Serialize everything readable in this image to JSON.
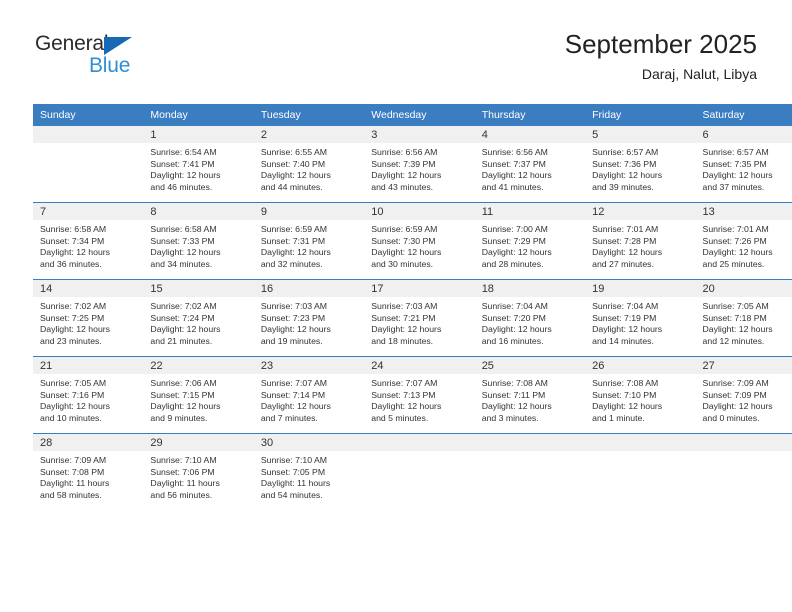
{
  "brand": {
    "name_dark": "General",
    "name_light": "Blue",
    "triangle_color": "#1669b2",
    "light_color": "#2f8fd4"
  },
  "header": {
    "title": "September 2025",
    "subtitle": "Daraj, Nalut, Libya"
  },
  "theme": {
    "header_blue": "#3b7dc1",
    "day_band_gray": "#f0f0f0",
    "text_color": "#333333"
  },
  "weekdays": [
    "Sunday",
    "Monday",
    "Tuesday",
    "Wednesday",
    "Thursday",
    "Friday",
    "Saturday"
  ],
  "weeks": [
    [
      {
        "day": "",
        "sunrise": "",
        "sunset": "",
        "daylight1": "",
        "daylight2": ""
      },
      {
        "day": "1",
        "sunrise": "Sunrise: 6:54 AM",
        "sunset": "Sunset: 7:41 PM",
        "daylight1": "Daylight: 12 hours",
        "daylight2": "and 46 minutes."
      },
      {
        "day": "2",
        "sunrise": "Sunrise: 6:55 AM",
        "sunset": "Sunset: 7:40 PM",
        "daylight1": "Daylight: 12 hours",
        "daylight2": "and 44 minutes."
      },
      {
        "day": "3",
        "sunrise": "Sunrise: 6:56 AM",
        "sunset": "Sunset: 7:39 PM",
        "daylight1": "Daylight: 12 hours",
        "daylight2": "and 43 minutes."
      },
      {
        "day": "4",
        "sunrise": "Sunrise: 6:56 AM",
        "sunset": "Sunset: 7:37 PM",
        "daylight1": "Daylight: 12 hours",
        "daylight2": "and 41 minutes."
      },
      {
        "day": "5",
        "sunrise": "Sunrise: 6:57 AM",
        "sunset": "Sunset: 7:36 PM",
        "daylight1": "Daylight: 12 hours",
        "daylight2": "and 39 minutes."
      },
      {
        "day": "6",
        "sunrise": "Sunrise: 6:57 AM",
        "sunset": "Sunset: 7:35 PM",
        "daylight1": "Daylight: 12 hours",
        "daylight2": "and 37 minutes."
      }
    ],
    [
      {
        "day": "7",
        "sunrise": "Sunrise: 6:58 AM",
        "sunset": "Sunset: 7:34 PM",
        "daylight1": "Daylight: 12 hours",
        "daylight2": "and 36 minutes."
      },
      {
        "day": "8",
        "sunrise": "Sunrise: 6:58 AM",
        "sunset": "Sunset: 7:33 PM",
        "daylight1": "Daylight: 12 hours",
        "daylight2": "and 34 minutes."
      },
      {
        "day": "9",
        "sunrise": "Sunrise: 6:59 AM",
        "sunset": "Sunset: 7:31 PM",
        "daylight1": "Daylight: 12 hours",
        "daylight2": "and 32 minutes."
      },
      {
        "day": "10",
        "sunrise": "Sunrise: 6:59 AM",
        "sunset": "Sunset: 7:30 PM",
        "daylight1": "Daylight: 12 hours",
        "daylight2": "and 30 minutes."
      },
      {
        "day": "11",
        "sunrise": "Sunrise: 7:00 AM",
        "sunset": "Sunset: 7:29 PM",
        "daylight1": "Daylight: 12 hours",
        "daylight2": "and 28 minutes."
      },
      {
        "day": "12",
        "sunrise": "Sunrise: 7:01 AM",
        "sunset": "Sunset: 7:28 PM",
        "daylight1": "Daylight: 12 hours",
        "daylight2": "and 27 minutes."
      },
      {
        "day": "13",
        "sunrise": "Sunrise: 7:01 AM",
        "sunset": "Sunset: 7:26 PM",
        "daylight1": "Daylight: 12 hours",
        "daylight2": "and 25 minutes."
      }
    ],
    [
      {
        "day": "14",
        "sunrise": "Sunrise: 7:02 AM",
        "sunset": "Sunset: 7:25 PM",
        "daylight1": "Daylight: 12 hours",
        "daylight2": "and 23 minutes."
      },
      {
        "day": "15",
        "sunrise": "Sunrise: 7:02 AM",
        "sunset": "Sunset: 7:24 PM",
        "daylight1": "Daylight: 12 hours",
        "daylight2": "and 21 minutes."
      },
      {
        "day": "16",
        "sunrise": "Sunrise: 7:03 AM",
        "sunset": "Sunset: 7:23 PM",
        "daylight1": "Daylight: 12 hours",
        "daylight2": "and 19 minutes."
      },
      {
        "day": "17",
        "sunrise": "Sunrise: 7:03 AM",
        "sunset": "Sunset: 7:21 PM",
        "daylight1": "Daylight: 12 hours",
        "daylight2": "and 18 minutes."
      },
      {
        "day": "18",
        "sunrise": "Sunrise: 7:04 AM",
        "sunset": "Sunset: 7:20 PM",
        "daylight1": "Daylight: 12 hours",
        "daylight2": "and 16 minutes."
      },
      {
        "day": "19",
        "sunrise": "Sunrise: 7:04 AM",
        "sunset": "Sunset: 7:19 PM",
        "daylight1": "Daylight: 12 hours",
        "daylight2": "and 14 minutes."
      },
      {
        "day": "20",
        "sunrise": "Sunrise: 7:05 AM",
        "sunset": "Sunset: 7:18 PM",
        "daylight1": "Daylight: 12 hours",
        "daylight2": "and 12 minutes."
      }
    ],
    [
      {
        "day": "21",
        "sunrise": "Sunrise: 7:05 AM",
        "sunset": "Sunset: 7:16 PM",
        "daylight1": "Daylight: 12 hours",
        "daylight2": "and 10 minutes."
      },
      {
        "day": "22",
        "sunrise": "Sunrise: 7:06 AM",
        "sunset": "Sunset: 7:15 PM",
        "daylight1": "Daylight: 12 hours",
        "daylight2": "and 9 minutes."
      },
      {
        "day": "23",
        "sunrise": "Sunrise: 7:07 AM",
        "sunset": "Sunset: 7:14 PM",
        "daylight1": "Daylight: 12 hours",
        "daylight2": "and 7 minutes."
      },
      {
        "day": "24",
        "sunrise": "Sunrise: 7:07 AM",
        "sunset": "Sunset: 7:13 PM",
        "daylight1": "Daylight: 12 hours",
        "daylight2": "and 5 minutes."
      },
      {
        "day": "25",
        "sunrise": "Sunrise: 7:08 AM",
        "sunset": "Sunset: 7:11 PM",
        "daylight1": "Daylight: 12 hours",
        "daylight2": "and 3 minutes."
      },
      {
        "day": "26",
        "sunrise": "Sunrise: 7:08 AM",
        "sunset": "Sunset: 7:10 PM",
        "daylight1": "Daylight: 12 hours",
        "daylight2": "and 1 minute."
      },
      {
        "day": "27",
        "sunrise": "Sunrise: 7:09 AM",
        "sunset": "Sunset: 7:09 PM",
        "daylight1": "Daylight: 12 hours",
        "daylight2": "and 0 minutes."
      }
    ],
    [
      {
        "day": "28",
        "sunrise": "Sunrise: 7:09 AM",
        "sunset": "Sunset: 7:08 PM",
        "daylight1": "Daylight: 11 hours",
        "daylight2": "and 58 minutes."
      },
      {
        "day": "29",
        "sunrise": "Sunrise: 7:10 AM",
        "sunset": "Sunset: 7:06 PM",
        "daylight1": "Daylight: 11 hours",
        "daylight2": "and 56 minutes."
      },
      {
        "day": "30",
        "sunrise": "Sunrise: 7:10 AM",
        "sunset": "Sunset: 7:05 PM",
        "daylight1": "Daylight: 11 hours",
        "daylight2": "and 54 minutes."
      },
      {
        "day": "",
        "sunrise": "",
        "sunset": "",
        "daylight1": "",
        "daylight2": ""
      },
      {
        "day": "",
        "sunrise": "",
        "sunset": "",
        "daylight1": "",
        "daylight2": ""
      },
      {
        "day": "",
        "sunrise": "",
        "sunset": "",
        "daylight1": "",
        "daylight2": ""
      },
      {
        "day": "",
        "sunrise": "",
        "sunset": "",
        "daylight1": "",
        "daylight2": ""
      }
    ]
  ]
}
